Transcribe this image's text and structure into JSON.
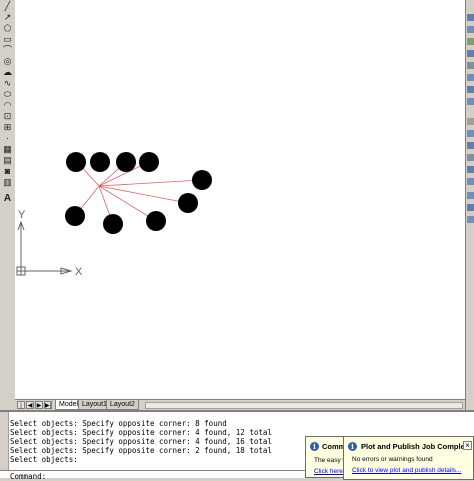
{
  "tabs": [
    {
      "label": "Model",
      "active": true
    },
    {
      "label": "Layout1",
      "active": false
    },
    {
      "label": "Layout2",
      "active": false
    }
  ],
  "nav_buttons": [
    "|◀",
    "◀",
    "▶",
    "▶|"
  ],
  "ucs": {
    "y_label": "Y",
    "x_label": "X"
  },
  "left_toolbar_icons": [
    "line-icon",
    "polyline-icon",
    "polygon-icon",
    "rectangle-icon",
    "arc-icon",
    "circle-icon",
    "revcloud-icon",
    "spline-icon",
    "ellipse-icon",
    "ellipse-arc-icon",
    "insert-block-icon",
    "make-block-icon",
    "point-icon",
    "hatch-icon",
    "gradient-icon",
    "region-icon",
    "table-icon",
    "multiline-text-icon"
  ],
  "command_history": [
    "Select objects: Specify opposite corner: 8 found",
    "Select objects: Specify opposite corner: 4 found, 12 total",
    "Select objects: Specify opposite corner: 4 found, 16 total",
    "Select objects: Specify opposite corner: 2 found, 18 total",
    "Select objects:"
  ],
  "command_prompt": "Command:",
  "balloon_back": {
    "title": "Comm",
    "text": "The easy w",
    "link": "Click here"
  },
  "balloon_front": {
    "title": "Plot and Publish Job Complete",
    "text": "No errors or warnings found",
    "link": "Click to view plot and publish details..."
  },
  "colors": {
    "circle_fill": "#000000",
    "line_color": "#e06060",
    "ucs_color": "#606060"
  }
}
